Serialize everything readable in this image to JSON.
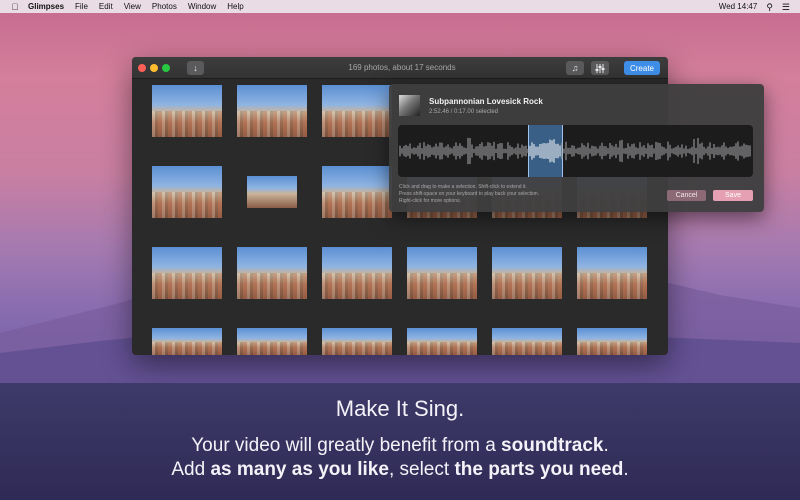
{
  "menubar": {
    "app": "Glimpses",
    "items": [
      "File",
      "Edit",
      "View",
      "Photos",
      "Window",
      "Help"
    ],
    "clock": "Wed 14:47"
  },
  "window": {
    "title": "169 photos, about 17 seconds",
    "create_label": "Create"
  },
  "popover": {
    "track_title": "Subpannonian Lovesick Rock",
    "track_meta": "2:52.46 / 0:17.00 selected",
    "help_lines": [
      "Click and drag to make a selection. Shift-click to extend it.",
      "Press shift-space on your keyboard to play back your selection.",
      "Right-click for more options."
    ],
    "cancel_label": "Cancel",
    "save_label": "Save"
  },
  "caption": {
    "headline": "Make It Sing.",
    "line1_a": "Your video will greatly benefit from a ",
    "line1_b": "soundtrack",
    "line1_c": ".",
    "line2_a": "Add ",
    "line2_b": "as many as you like",
    "line2_c": ", select ",
    "line2_d": "the parts you need",
    "line2_e": "."
  },
  "colors": {
    "accent": "#3e8ee8",
    "selection": "#3a5f86",
    "save_button": "#e6a0b4"
  }
}
